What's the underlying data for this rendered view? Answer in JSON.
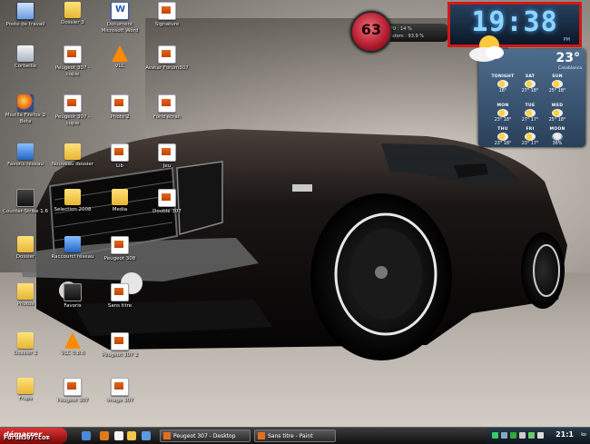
{
  "desktop": {
    "watermark": "Forum307.com",
    "icons": [
      {
        "label": "Poste de travail",
        "glyph": "computer-icon"
      },
      {
        "label": "Corbeille",
        "glyph": "recycle-bin-icon"
      },
      {
        "label": "Mozilla Firefox 3 Beta",
        "glyph": "firefox-icon"
      },
      {
        "label": "Favoris réseau",
        "glyph": "network-icon"
      },
      {
        "label": "Counter-Strike 1.6",
        "glyph": "game-icon"
      },
      {
        "label": "Dossier",
        "glyph": "folder-icon"
      },
      {
        "label": "Photos",
        "glyph": "folder-icon"
      },
      {
        "label": "Dossier 2",
        "glyph": "folder-icon"
      },
      {
        "label": "Fraps",
        "glyph": "folder-icon"
      },
      {
        "label": "Dossier 3",
        "glyph": "folder-icon"
      },
      {
        "label": "Peugeot 307 - copie",
        "glyph": "image-icon"
      },
      {
        "label": "Peugeot 307 - copie",
        "glyph": "image-icon"
      },
      {
        "label": "Nouveau dossier",
        "glyph": "folder-icon"
      },
      {
        "label": "Selection 2008",
        "glyph": "folder-icon"
      },
      {
        "label": "Raccourci réseau",
        "glyph": "network-icon"
      },
      {
        "label": "Favoris",
        "glyph": "game-icon"
      },
      {
        "label": "VLC 0.8.6",
        "glyph": "vlc-icon"
      },
      {
        "label": "Peugeot 307",
        "glyph": "image-icon"
      },
      {
        "label": "Document Microsoft Word",
        "glyph": "word-icon"
      },
      {
        "label": "VLC",
        "glyph": "vlc-icon"
      },
      {
        "label": "Photo 2",
        "glyph": "image-icon"
      },
      {
        "label": "Lib",
        "glyph": "image-icon"
      },
      {
        "label": "Media",
        "glyph": "folder-icon"
      },
      {
        "label": "Peugeot 308",
        "glyph": "image-icon"
      },
      {
        "label": "Sans titre",
        "glyph": "image-icon"
      },
      {
        "label": "Peugeot 307 2",
        "glyph": "image-icon"
      },
      {
        "label": "Image 307",
        "glyph": "image-icon"
      },
      {
        "label": "Signature",
        "glyph": "image-icon"
      },
      {
        "label": "Avatar Forum307",
        "glyph": "image-icon"
      },
      {
        "label": "Fond écran",
        "glyph": "image-icon"
      },
      {
        "label": "Jeu",
        "glyph": "image-icon"
      },
      {
        "label": "Double 307",
        "glyph": "image-icon"
      }
    ]
  },
  "cpu": {
    "value": "63",
    "line1": "CPU : 14 %",
    "line2": "System : 93.9 %"
  },
  "clock": {
    "time": "19:38",
    "ampm": "PM"
  },
  "weather": {
    "temp": "23°",
    "city": "Casablanca",
    "forecast": [
      {
        "day": "TONIGHT",
        "hi": "",
        "lo": "18°",
        "type": "moon"
      },
      {
        "day": "SAT",
        "hi": "27°",
        "lo": "18°",
        "type": "sun"
      },
      {
        "day": "SUN",
        "hi": "25°",
        "lo": "18°",
        "type": "sun"
      },
      {
        "day": "MON",
        "hi": "23°",
        "lo": "18°",
        "type": "sun"
      },
      {
        "day": "TUE",
        "hi": "27°",
        "lo": "17°",
        "type": "sun"
      },
      {
        "day": "WED",
        "hi": "25°",
        "lo": "18°",
        "type": "sun"
      },
      {
        "day": "THU",
        "hi": "23°",
        "lo": "18°",
        "type": "sun"
      },
      {
        "day": "FRI",
        "hi": "23°",
        "lo": "17°",
        "type": "sun"
      },
      {
        "day": "MOON",
        "hi": "36%",
        "lo": "",
        "type": "rain"
      }
    ]
  },
  "taskbar": {
    "start_label": "démarrer",
    "tasks": [
      {
        "label": "Peugeot 307 - Desktop"
      },
      {
        "label": "Sans titre - Paint"
      }
    ],
    "tray_time": "21:1",
    "tray_suffix": "ko"
  },
  "colors": {
    "accent": "#d21818",
    "clock": "#8fd6ff",
    "cpu": "#b01a2c"
  }
}
